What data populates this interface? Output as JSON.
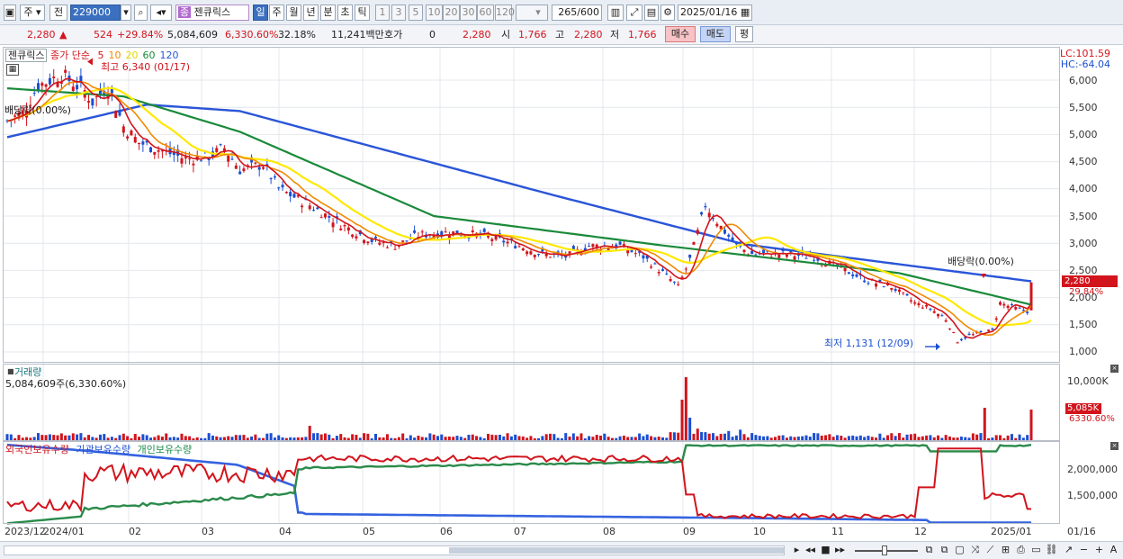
{
  "toolbar": {
    "market_type": "주",
    "prev_label": "전",
    "code": "229000",
    "stock_badge": "종",
    "stock_name": "젠큐릭스",
    "periods": [
      "일",
      "주",
      "월",
      "년",
      "분",
      "초",
      "틱"
    ],
    "selected_period": "일",
    "intervals": [
      "1",
      "3",
      "5",
      "10",
      "20",
      "30",
      "60",
      "120"
    ],
    "count": "265",
    "count_total": "/600",
    "date": "2025/01/16"
  },
  "info": {
    "price": "2,280",
    "change": "524",
    "change_pct": "+29.84%",
    "volume": "5,084,609",
    "vol_ratio": "6,330.60%",
    "turnover": "32.18%",
    "amount": "11,241백만",
    "hoga_label": "호가",
    "hoga_value": "0",
    "hoga_price": "2,280",
    "open_label": "시",
    "open": "1,766",
    "high_label": "고",
    "high": "2,280",
    "low_label": "저",
    "low": "1,766",
    "buy": "매수",
    "sell": "매도",
    "avg": "평"
  },
  "price_panel": {
    "stock_name": "젠큐릭스",
    "legend_prefix": "종가 단순",
    "ma": [
      {
        "label": "5",
        "color": "#d2141c"
      },
      {
        "label": "10",
        "color": "#f08a00"
      },
      {
        "label": "20",
        "color": "#e6d800"
      },
      {
        "label": "60",
        "color": "#1a8a3a"
      },
      {
        "label": "120",
        "color": "#2a55d8"
      }
    ],
    "lc": "LC:101.59",
    "hc": "HC:-64.04",
    "high_note": "최고 6,340 (01/17)",
    "low_note": "최저 1,131 (12/09)",
    "div_note": "배당락(0.00%)",
    "left_note": "배당락(0.00%)",
    "price_tag": "2,280",
    "pct_tag": "29.84%",
    "y_ticks": [
      "6,000",
      "5,500",
      "5,000",
      "4,500",
      "4,000",
      "3,500",
      "3,000",
      "2,500",
      "2,000",
      "1,500",
      "1,000"
    ]
  },
  "volume_panel": {
    "title": "거래량",
    "value": "5,084,609주(6,330.60%)",
    "tick": "10,000K",
    "tag": "5,085K",
    "tag2": "6330.60%"
  },
  "holdings_panel": {
    "legend": [
      "외국인보유수량",
      "기관보유수량",
      "개인보유수량"
    ],
    "ticks": [
      "2,000,000",
      "1,500,000"
    ]
  },
  "x_labels": [
    "2023/12",
    "2024/01",
    "02",
    "03",
    "04",
    "05",
    "06",
    "07",
    "08",
    "09",
    "10",
    "11",
    "12",
    "2025/01",
    "01/16"
  ],
  "colors": {
    "up": "#d2141c",
    "down": "#1b4fd1",
    "ma5": "#d2141c",
    "ma10": "#f08a00",
    "ma20": "#ffe800",
    "ma60": "#1a8a3a",
    "ma120": "#2a55d8"
  }
}
